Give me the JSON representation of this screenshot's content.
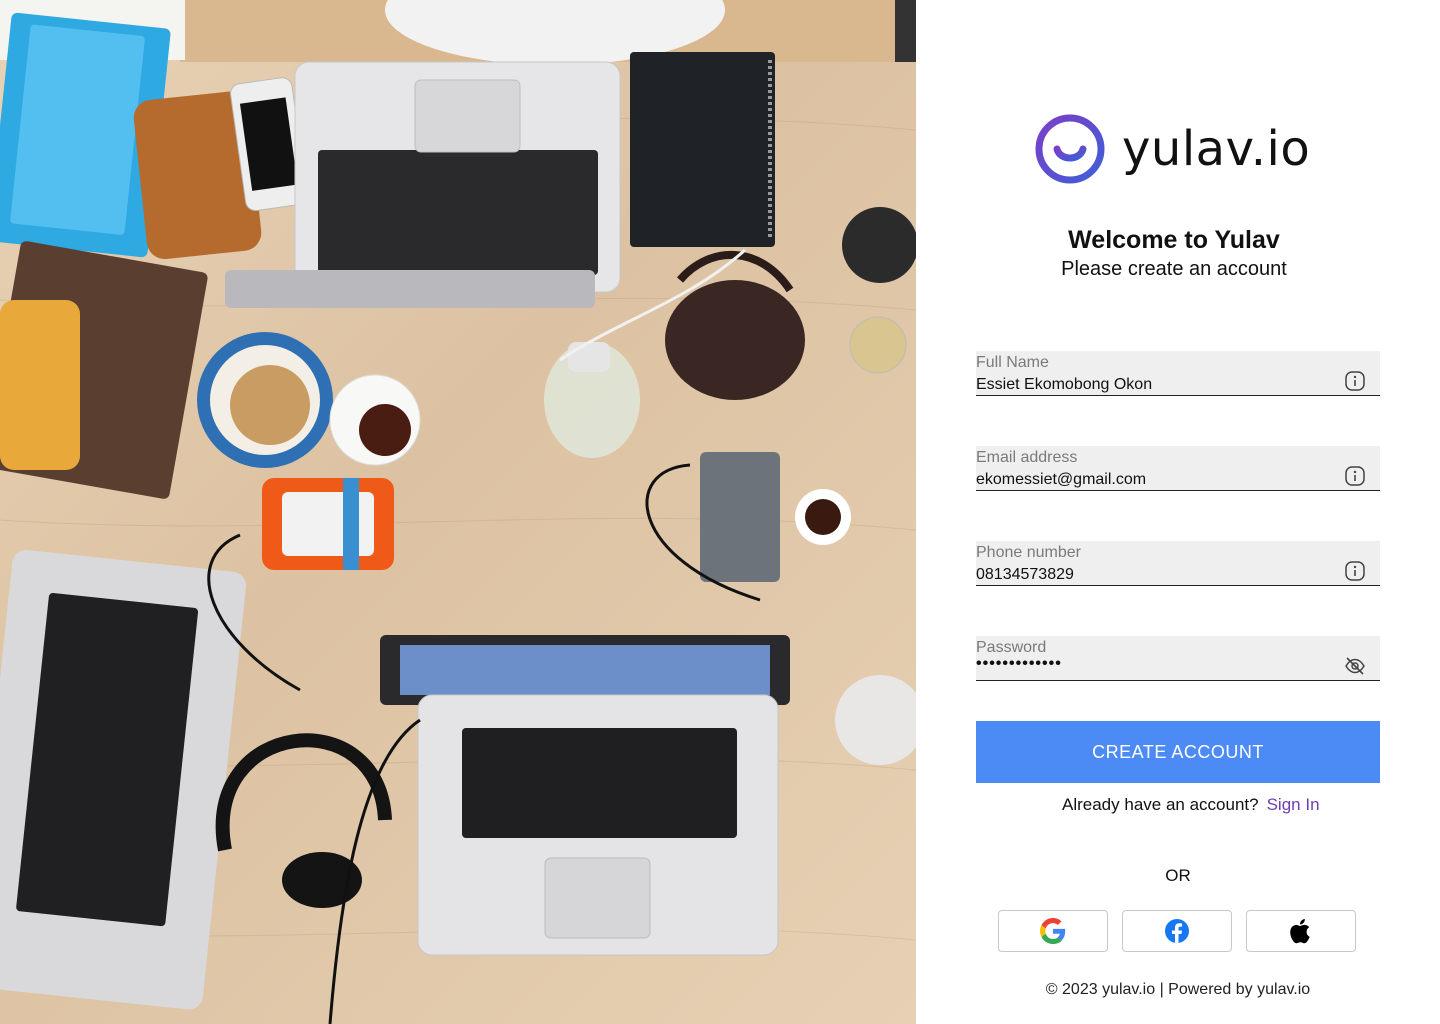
{
  "brand": {
    "name": "yulav.io",
    "accent": "#5a3fc7"
  },
  "welcome": {
    "title": "Welcome to Yulav",
    "subtitle": "Please create an account"
  },
  "form": {
    "full_name": {
      "label": "Full Name",
      "value": "Essiet Ekomobong Okon",
      "icon": "info-icon"
    },
    "email": {
      "label": "Email address",
      "value": "ekomessiet@gmail.com",
      "icon": "info-icon"
    },
    "phone": {
      "label": "Phone number",
      "value": "08134573829",
      "icon": "info-icon"
    },
    "password": {
      "label": "Password",
      "value": "•••••••••••••",
      "icon": "eye-off-icon"
    },
    "submit_label": "CREATE ACCOUNT",
    "submit_color": "#4c8bf5"
  },
  "signin": {
    "prompt": "Already have an account?",
    "link": "Sign In"
  },
  "divider": "OR",
  "social": [
    {
      "name": "google",
      "icon": "google-icon"
    },
    {
      "name": "facebook",
      "icon": "facebook-icon"
    },
    {
      "name": "apple",
      "icon": "apple-icon"
    }
  ],
  "footer": "© 2023 yulav.io |  Powered by yulav.io",
  "hero": {
    "description_icon": "workspace-photo"
  }
}
